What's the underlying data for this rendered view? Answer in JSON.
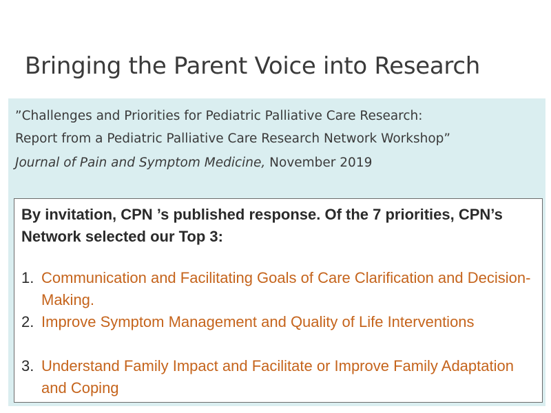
{
  "slide": {
    "title": "Bringing the Parent Voice into Research",
    "reference": {
      "line1": "”Challenges and Priorities for Pediatric Palliative Care Research:",
      "line2": "Report from a Pediatric Palliative Care Research Network Workshop”",
      "journal": "Journal of Pain and Symptom Medicine,",
      "date": " November 2019"
    },
    "callout": {
      "intro": "By invitation, CPN ’s published response. Of the 7 priorities, CPN’s Network selected our Top 3:",
      "items": [
        {
          "number": "1.",
          "text": "Communication and Facilitating Goals of Care Clarification and Decision-Making."
        },
        {
          "number": "2.",
          "text": "Improve Symptom Management and Quality of Life Interventions"
        },
        {
          "number": "3.",
          "text": "Understand Family Impact and Facilitate or Improve Family Adaptation and Coping"
        }
      ]
    },
    "colors": {
      "panel_background": "#daeef0",
      "priority_text": "#c5641c",
      "title_text": "#3a3a3a"
    }
  }
}
